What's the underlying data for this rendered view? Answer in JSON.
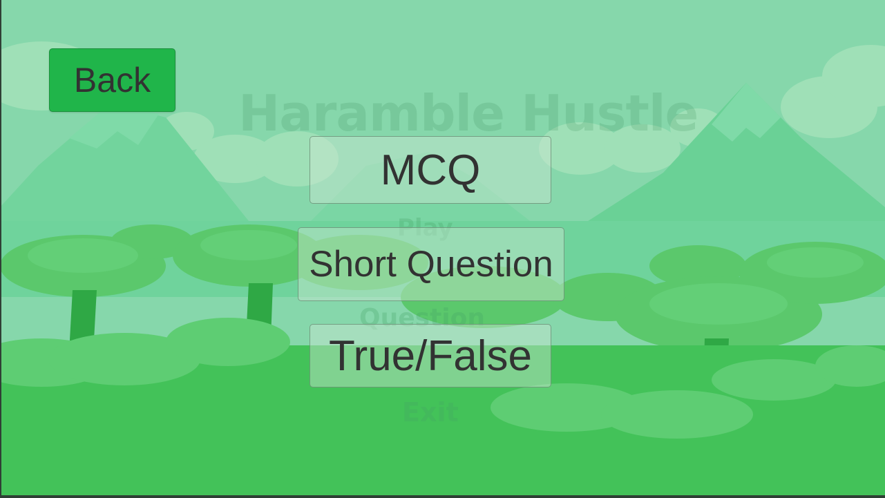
{
  "background": {
    "scene": "jungle-landscape",
    "colors": {
      "sky": "#86d7ab",
      "far_mountain": "#6fd39a",
      "far_cloud": "#9fe0b7",
      "tree_canopy": "#58c86a",
      "ground": "#43c259"
    },
    "faded_title": "Haramble Hustle",
    "faded_menu": [
      "Play",
      "Question",
      "Exit"
    ]
  },
  "buttons": {
    "back": "Back",
    "mcq": "MCQ",
    "short_question": "Short Question",
    "true_false": "True/False"
  },
  "colors": {
    "back_button": "#20b54a",
    "button_text": "#323232"
  }
}
